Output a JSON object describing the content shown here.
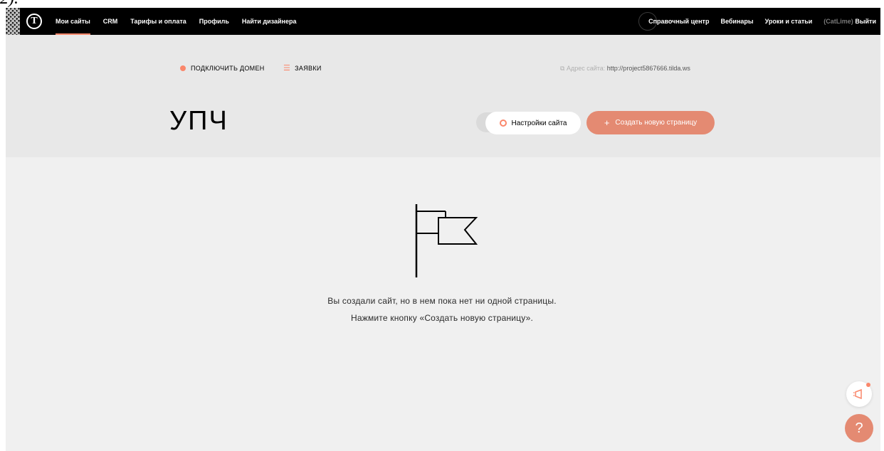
{
  "crop_text": "2).",
  "nav": {
    "items": [
      "Мои сайты",
      "CRM",
      "Тарифы и оплата",
      "Профиль",
      "Найти дизайнера"
    ],
    "active_index": 0
  },
  "rnav": {
    "help_center": "Справочный центр",
    "webinars": "Вебинары",
    "lessons": "Уроки и статьи",
    "user": "(CatLime)",
    "logout": "Выйти"
  },
  "sub": {
    "connect_domain": "ПОДКЛЮЧИТЬ ДОМЕН",
    "requests": "ЗАЯВКИ",
    "address_label": "Адрес сайта:",
    "address_url": "http://project5867666.tilda.ws"
  },
  "project": {
    "title": "УПЧ",
    "settings_label": "Настройки сайта",
    "create_label": "Создать новую страницу"
  },
  "empty": {
    "line1": "Вы создали сайт, но в нем пока нет ни одной страницы.",
    "line2": "Нажмите кнопку «Создать новую страницу»."
  },
  "float": {
    "help_symbol": "?"
  },
  "colors": {
    "accent": "#fa876b",
    "create_button": "#e48a72",
    "topbar": "#000000",
    "header_bg": "#e8e8e8",
    "main_bg": "#f0f0f0"
  },
  "icons": [
    "logo-icon",
    "help-center-icon",
    "dot-icon",
    "lines-icon",
    "external-link-icon",
    "ring-icon",
    "plus-icon",
    "flag-icon",
    "megaphone-icon",
    "help-icon"
  ]
}
